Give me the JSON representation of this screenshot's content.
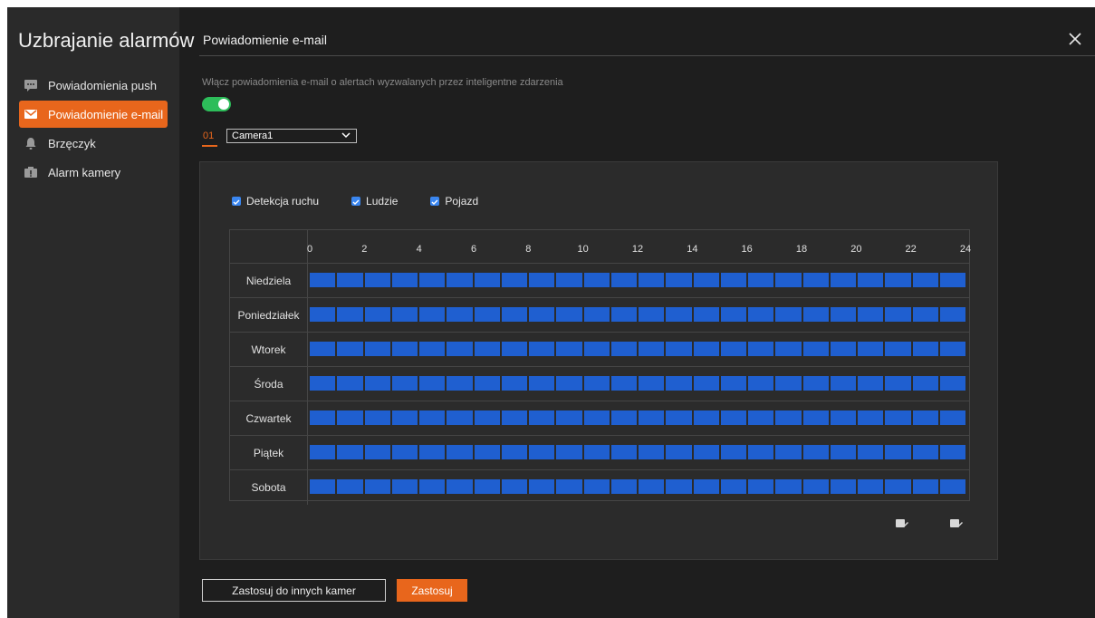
{
  "sidebar": {
    "title": "Uzbrajanie alarmów",
    "items": [
      {
        "label": "Powiadomienia push",
        "icon": "chat-icon",
        "active": false
      },
      {
        "label": "Powiadomienie e-mail",
        "icon": "mail-icon",
        "active": true
      },
      {
        "label": "Brzęczyk",
        "icon": "bell-icon",
        "active": false
      },
      {
        "label": "Alarm kamery",
        "icon": "camera-alarm-icon",
        "active": false
      }
    ]
  },
  "header": {
    "title": "Powiadomienie e-mail",
    "close_icon": "close-icon"
  },
  "settings": {
    "description": "Włącz powiadomienia e-mail o alertach wyzwalanych przez inteligentne zdarzenia",
    "toggle_on": true,
    "camera_number": "01",
    "camera_selected": "Camera1"
  },
  "filters": [
    {
      "label": "Detekcja ruchu",
      "checked": true
    },
    {
      "label": "Ludzie",
      "checked": true
    },
    {
      "label": "Pojazd",
      "checked": true
    }
  ],
  "schedule": {
    "hour_labels": [
      "0",
      "2",
      "4",
      "6",
      "8",
      "10",
      "12",
      "14",
      "16",
      "18",
      "20",
      "22",
      "24"
    ],
    "days": [
      "Niedziela",
      "Poniedziałek",
      "Wtorek",
      "Środa",
      "Czwartek",
      "Piątek",
      "Sobota"
    ],
    "slots_per_day": 24,
    "slot_color": "#1f5fd0"
  },
  "actions": {
    "apply_others": "Zastosuj do innych kamer",
    "apply": "Zastosuj"
  },
  "colors": {
    "accent": "#e8661c",
    "toggle": "#2dbd5a",
    "checkbox": "#3a86f0"
  }
}
